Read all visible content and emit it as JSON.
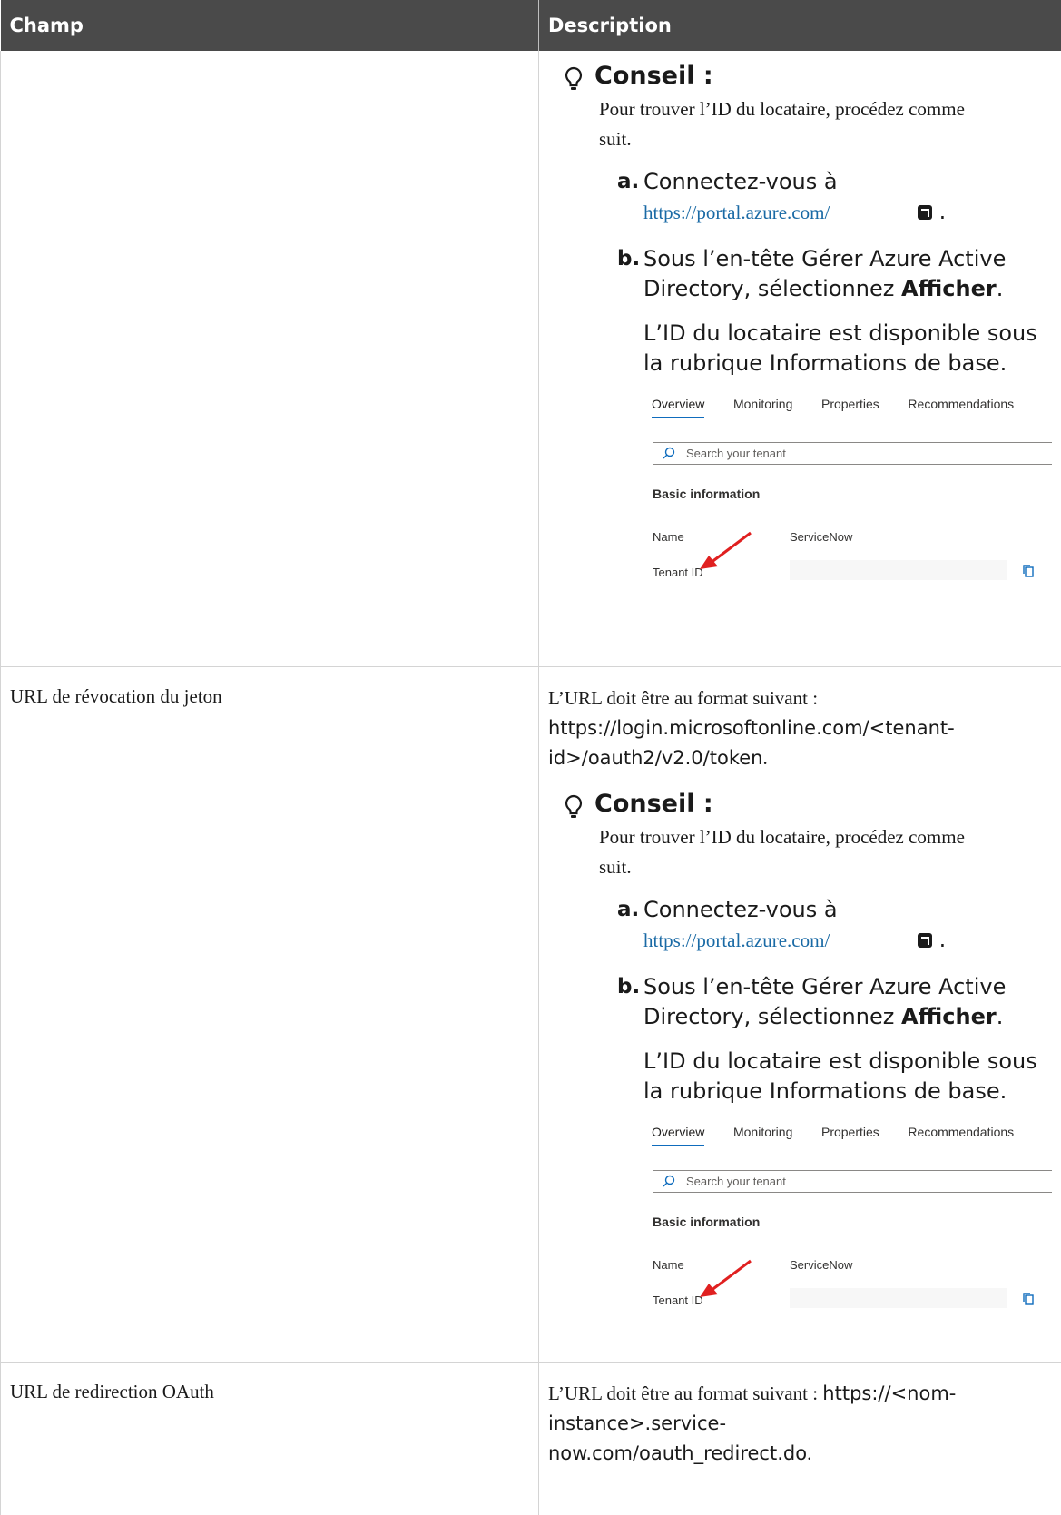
{
  "table": {
    "headers": {
      "field": "Champ",
      "description": "Description"
    }
  },
  "tip": {
    "title": "Conseil :",
    "intro": "Pour trouver l’ID du locataire, procédez comme suit.",
    "step_a_label": "a.",
    "step_a_text": "Connectez-vous à",
    "step_a_link": "https://portal.azure.com/",
    "step_a_end": ".",
    "step_b_label": "b.",
    "step_b_text": "Sous l’en-tête Gérer Azure Active Directory, sélectionnez",
    "step_b_bold": "Afficher",
    "step_b_end": ".",
    "step_b_note": "L’ID du locataire est disponible sous la rubrique Informations de base."
  },
  "azure_screenshot": {
    "tabs": [
      "Overview",
      "Monitoring",
      "Properties",
      "Recommendations"
    ],
    "search_placeholder": "Search your tenant",
    "section_title": "Basic information",
    "name_label": "Name",
    "name_value": "ServiceNow",
    "tenant_label": "Tenant ID",
    "arrow_color": "#e02020"
  },
  "rows": [
    {
      "field": ""
    },
    {
      "field": "URL de révocation du jeton",
      "url_prefix": "L’URL doit être au format suivant :",
      "url_value": "https://login.microsoftonline.com/<tenant-id>/oauth2/v2.0/token",
      "url_end": "."
    },
    {
      "field": "URL de redirection OAuth",
      "url_prefix": "L’URL doit être au format suivant :",
      "url_value": "https://<nom-instance>.service-now.com/oauth_redirect.do",
      "url_end": "."
    }
  ],
  "colors": {
    "header_bg": "#4a4a4a",
    "link": "#1a6aa5",
    "tab_underline": "#0f6cbd"
  }
}
